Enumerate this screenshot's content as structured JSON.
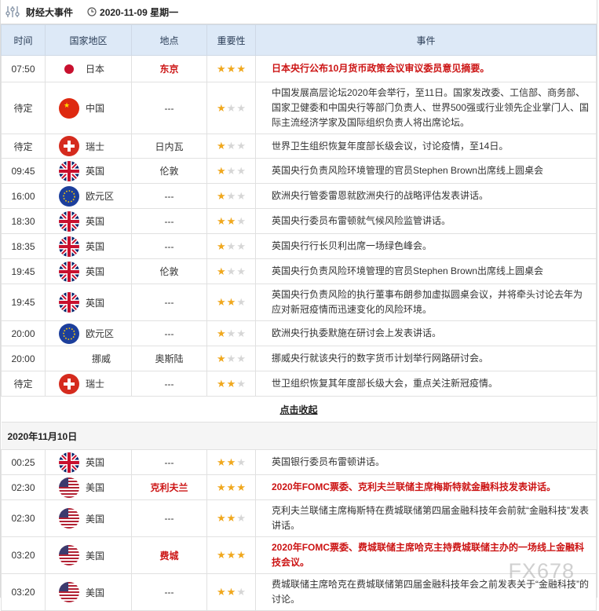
{
  "header": {
    "title": "财经大事件",
    "date": "2020-11-09 星期一"
  },
  "columns": [
    "时间",
    "国家地区",
    "地点",
    "重要性",
    "事件"
  ],
  "colors": {
    "highlight": "#cc1414",
    "star_on": "#f0a81e",
    "star_off": "#d6d6d6",
    "header_bg": "#dde9f7"
  },
  "rows_day1": [
    {
      "time": "07:50",
      "flag": "jp",
      "country": "日本",
      "location": "东京",
      "stars": 3,
      "event": "日本央行公布10月货币政策会议审议委员意见摘要。",
      "highlight": true
    },
    {
      "time": "待定",
      "flag": "cn",
      "country": "中国",
      "location": "---",
      "stars": 1,
      "event": "中国发展高层论坛2020年会举行，至11日。国家发改委、工信部、商务部、国家卫健委和中国央行等部门负责人、世界500强或行业领先企业掌门人、国际主流经济学家及国际组织负责人将出席论坛。",
      "highlight": false
    },
    {
      "time": "待定",
      "flag": "ch",
      "country": "瑞士",
      "location": "日内瓦",
      "stars": 1,
      "event": "世界卫生组织恢复年度部长级会议，讨论疫情，至14日。",
      "highlight": false
    },
    {
      "time": "09:45",
      "flag": "uk",
      "country": "英国",
      "location": "伦敦",
      "stars": 1,
      "event": "英国央行负责风险环境管理的官员Stephen Brown出席线上圆桌会",
      "highlight": false
    },
    {
      "time": "16:00",
      "flag": "eu",
      "country": "欧元区",
      "location": "---",
      "stars": 1,
      "event": "欧洲央行管委雷恩就欧洲央行的战略评估发表讲话。",
      "highlight": false
    },
    {
      "time": "18:30",
      "flag": "uk",
      "country": "英国",
      "location": "---",
      "stars": 2,
      "event": "英国央行委员布雷顿就气候风险监管讲话。",
      "highlight": false
    },
    {
      "time": "18:35",
      "flag": "uk",
      "country": "英国",
      "location": "---",
      "stars": 1,
      "event": "英国央行行长贝利出席一场绿色峰会。",
      "highlight": false
    },
    {
      "time": "19:45",
      "flag": "uk",
      "country": "英国",
      "location": "伦敦",
      "stars": 1,
      "event": "英国央行负责风险环境管理的官员Stephen Brown出席线上圆桌会",
      "highlight": false
    },
    {
      "time": "19:45",
      "flag": "uk",
      "country": "英国",
      "location": "---",
      "stars": 2,
      "event": "英国央行负责风险的执行董事布朗参加虚拟圆桌会议，并将牵头讨论去年为应对新冠疫情而迅速变化的风险环境。",
      "highlight": false
    },
    {
      "time": "20:00",
      "flag": "eu",
      "country": "欧元区",
      "location": "---",
      "stars": 1,
      "event": "欧洲央行执委默施在研讨会上发表讲话。",
      "highlight": false
    },
    {
      "time": "20:00",
      "flag": "none",
      "country": "挪威",
      "location": "奥斯陆",
      "stars": 1,
      "event": "挪威央行就该央行的数字货币计划举行网路研讨会。",
      "highlight": false
    },
    {
      "time": "待定",
      "flag": "ch",
      "country": "瑞士",
      "location": "---",
      "stars": 2,
      "event": "世卫组织恢复其年度部长级大会，重点关注新冠疫情。",
      "highlight": false
    }
  ],
  "collapse_label": "点击收起",
  "date2": "2020年11月10日",
  "rows_day2": [
    {
      "time": "00:25",
      "flag": "uk",
      "country": "英国",
      "location": "---",
      "stars": 2,
      "event": "英国银行委员布雷顿讲话。",
      "highlight": false
    },
    {
      "time": "02:30",
      "flag": "us",
      "country": "美国",
      "location": "克利夫兰",
      "stars": 3,
      "event": "2020年FOMC票委、克利夫兰联储主席梅斯特就金融科技发表讲话。",
      "highlight": true
    },
    {
      "time": "02:30",
      "flag": "us",
      "country": "美国",
      "location": "---",
      "stars": 2,
      "event": "克利夫兰联储主席梅斯特在费城联储第四届金融科技年会前就“金融科技”发表讲话。",
      "highlight": false
    },
    {
      "time": "03:20",
      "flag": "us",
      "country": "美国",
      "location": "费城",
      "stars": 3,
      "event": "2020年FOMC票委、费城联储主席哈克主持费城联储主办的一场线上金融科技会议。",
      "highlight": true
    },
    {
      "time": "03:20",
      "flag": "us",
      "country": "美国",
      "location": "---",
      "stars": 2,
      "event": "费城联储主席哈克在费城联储第四届金融科技年会之前发表关于“金融科技”的讨论。",
      "highlight": false
    }
  ],
  "watermark": "FX678"
}
